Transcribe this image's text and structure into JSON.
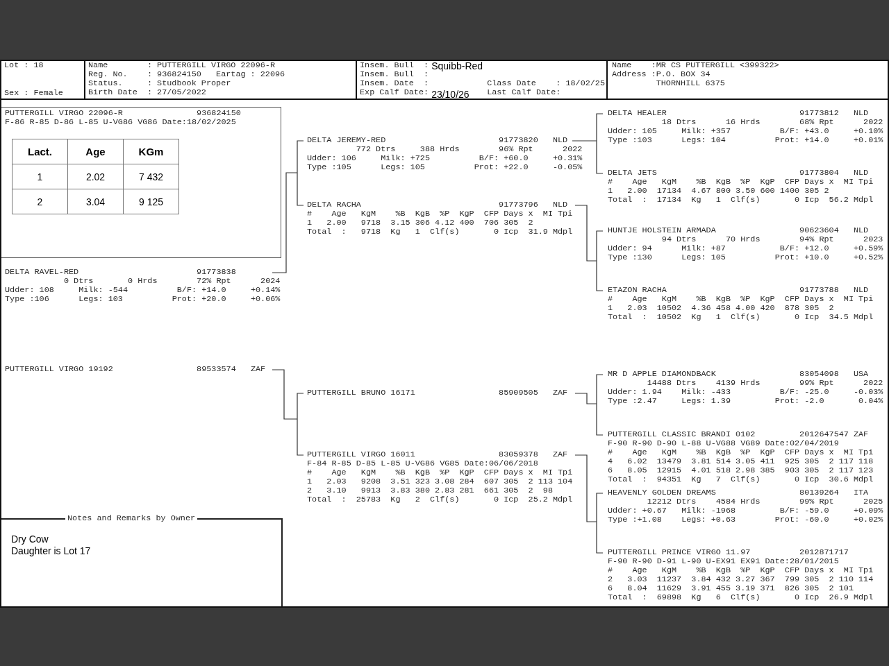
{
  "header": {
    "lot_cell": {
      "top": "Lot : 18",
      "bottom": "Sex : Female"
    },
    "animal_cell": {
      "lines": [
        "Name        : PUTTERGILL VIRGO 22096-R",
        "Reg. No.    : 936824150   Eartag : 22096",
        "Status.     : Studbook Proper",
        "Birth Date  : 27/05/2022"
      ]
    },
    "insem_cell": {
      "rows": [
        {
          "label": "Insem. Bull  :",
          "value": "Squibb-Red"
        },
        {
          "label": "Insem. Bull  :"
        },
        {
          "label": "Insem. Date  :",
          "right": "Class Date    : 18/02/25"
        },
        {
          "label": "Exp Calf Date:",
          "value": "23/10/26",
          "right": "Last Calf Date:"
        }
      ]
    },
    "owner_cell": {
      "lines": [
        "Name    :MR CS PUTTERGILL <399322>",
        "Address :P.O. BOX 34",
        "         THORNHILL 6375"
      ]
    }
  },
  "subject": {
    "lines": [
      "PUTTERGILL VIRGO 22096-R               936824150",
      "F-86 R-85 D-86 L-85 U-VG86 VG86 Date:18/02/2025"
    ],
    "table": {
      "columns": [
        "Lact.",
        "Age",
        "KGm"
      ],
      "rows": [
        [
          "1",
          "2.02",
          "7 432"
        ],
        [
          "2",
          "3.04",
          "9 125"
        ]
      ]
    }
  },
  "pedigree": [
    {
      "lines": [
        "DELTA RAVEL-RED                        91773838",
        "            0 Dtrs       0 Hrds        72% Rpt      2024",
        "Udder: 108     Milk: -544          B/F: +14.0     +0.14%",
        "Type :106      Legs: 103          Prot: +20.0     +0.06%"
      ]
    },
    {
      "lines": [
        "PUTTERGILL VIRGO 19192                 89533574   ZAF"
      ]
    },
    {
      "lines": [
        "DELTA JEREMY-RED                       91773820   NLD",
        "          772 Dtrs     388 Hrds        96% Rpt      2022",
        "Udder: 106     Milk: +725          B/F: +60.0     +0.31%",
        "Type :105      Legs: 105          Prot: +22.0     -0.05%"
      ]
    },
    {
      "lines": [
        "DELTA RACHA                            91773796   NLD",
        "#    Age   KgM    %B  KgB  %P  KgP  CFP Days x  MI Tpi",
        "1   2.00   9718  3.15 306 4.12 400  706 305  2",
        "Total  :   9718  Kg   1  Clf(s)       0 Icp  31.9 Mdpl"
      ]
    },
    {
      "lines": [
        "PUTTERGILL BRUNO 16171                 85909505   ZAF"
      ]
    },
    {
      "lines": [
        "PUTTERGILL VIRGO 16011                 83059378   ZAF",
        "F-84 R-85 D-85 L-85 U-VG86 VG85 Date:06/06/2018",
        "#    Age   KgM    %B  KgB  %P  KgP  CFP Days x  MI Tpi",
        "1   2.03   9208  3.51 323 3.08 284  607 305  2 113 104",
        "2   3.10   9913  3.83 380 2.83 281  661 305  2  98",
        "Total  :  25783  Kg   2  Clf(s)       0 Icp  25.2 Mdpl"
      ]
    },
    {
      "lines": [
        "DELTA HEALER                           91773812   NLD",
        "           18 Dtrs      16 Hrds        68% Rpt      2022",
        "Udder: 105     Milk: +357          B/F: +43.0     +0.10%",
        "Type :103      Legs: 104          Prot: +14.0     +0.01%"
      ]
    },
    {
      "lines": [
        "DELTA JETS                             91773804   NLD",
        "#    Age   KgM    %B  KgB  %P  KgP  CFP Days x  MI Tpi",
        "1   2.00  17134  4.67 800 3.50 600 1400 305 2",
        "Total  :  17134  Kg   1  Clf(s)       0 Icp  56.2 Mdpl"
      ]
    },
    {
      "lines": [
        "HUNTJE HOLSTEIN ARMADA                 90623604   NLD",
        "           94 Dtrs      70 Hrds        94% Rpt      2023",
        "Udder: 94      Milk: +87           B/F: +12.0     +0.59%",
        "Type :130      Legs: 105          Prot: +10.0     +0.52%"
      ]
    },
    {
      "lines": [
        "ETAZON RACHA                           91773788   NLD",
        "#    Age   KgM    %B  KgB  %P  KgP  CFP Days x  MI Tpi",
        "1   2.03  10502  4.36 458 4.00 420  878 305  2",
        "Total  :  10502  Kg   1  Clf(s)       0 Icp  34.5 Mdpl"
      ]
    },
    {
      "lines": [
        "MR D APPLE DIAMONDBACK                 83054098   USA",
        "        14488 Dtrs    4139 Hrds        99% Rpt      2022",
        "Udder: 1.94    Milk: -433          B/F: -25.0     -0.03%",
        "Type :2.47     Legs: 1.39         Prot: -2.0       0.04%"
      ]
    },
    {
      "lines": [
        "PUTTERGILL CLASSIC BRANDI 0102         2012647547 ZAF",
        "F-90 R-90 D-90 L-88 U-VG88 VG89 Date:02/04/2019",
        "#    Age   KgM    %B  KgB  %P  KgP  CFP Days x  MI Tpi",
        "4   6.02  13479  3.81 514 3.05 411  925 305  2 117 118",
        "6   8.05  12915  4.01 518 2.98 385  903 305  2 117 123",
        "Total  :  94351  Kg   7  Clf(s)       0 Icp  30.6 Mdpl"
      ]
    },
    {
      "lines": [
        "HEAVENLY GOLDEN DREAMS                 80139264   ITA",
        "        12212 Dtrs    4584 Hrds        99% Rpt      2025",
        "Udder: +0.67   Milk: -1968         B/F: -59.0     +0.09%",
        "Type :+1.08    Legs: +0.63        Prot: -60.0     +0.02%"
      ]
    },
    {
      "lines": [
        "PUTTERGILL PRINCE VIRGO 11.97          2012871717",
        "F-90 R-90 D-91 L-90 U-EX91 EX91 Date:28/01/2015",
        "#    Age   KgM    %B  KgB  %P  KgP  CFP Days x  MI Tpi",
        "2   3.03  11237  3.84 432 3.27 367  799 305  2 110 114",
        "6   8.04  11629  3.91 455 3.19 371  826 305  2 101",
        "Total  :  69898  Kg   6  Clf(s)       0 Icp  26.9 Mdpl"
      ]
    }
  ],
  "notes": {
    "title": "Notes and Remarks by Owner",
    "lines": [
      "Dry Cow",
      "Daughter is Lot 17"
    ]
  }
}
